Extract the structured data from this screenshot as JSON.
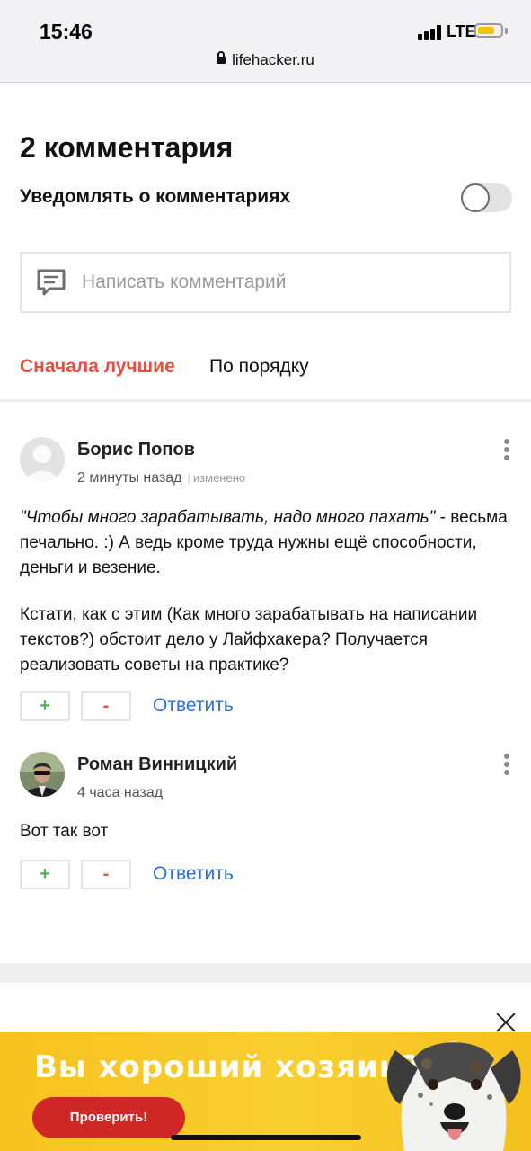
{
  "status_bar": {
    "time": "15:46",
    "network": "LTE",
    "url": "lifehacker.ru"
  },
  "comments_section": {
    "title": "2 комментария",
    "notify_label": "Уведомлять о комментариях",
    "notify_enabled": false,
    "input_placeholder": "Написать комментарий",
    "sort_tabs": [
      {
        "label": "Сначала лучшие",
        "active": true
      },
      {
        "label": "По порядку",
        "active": false
      }
    ],
    "comments": [
      {
        "author": "Борис Попов",
        "time": "2 минуты назад",
        "edited_label": "изменено",
        "quote": "\"Чтобы много зарабатывать, надо много пахать\"",
        "quote_tail": " - весьма печально. :) А ведь кроме труда нужны ещё способности, деньги и везение.",
        "paragraph2": "Кстати, как с этим (Как много зарабатывать на написании текстов?) обстоит дело у Лайфхакера? Получается реализовать советы на практике?",
        "upvote": "+",
        "downvote": "-",
        "reply": "Ответить"
      },
      {
        "author": "Роман Винницкий",
        "time": "4 часа назад",
        "text": "Вот так вот",
        "upvote": "+",
        "downvote": "-",
        "reply": "Ответить"
      }
    ]
  },
  "ad_banner": {
    "headline": "Вы хороший хозяин?",
    "button": "Проверить!"
  }
}
